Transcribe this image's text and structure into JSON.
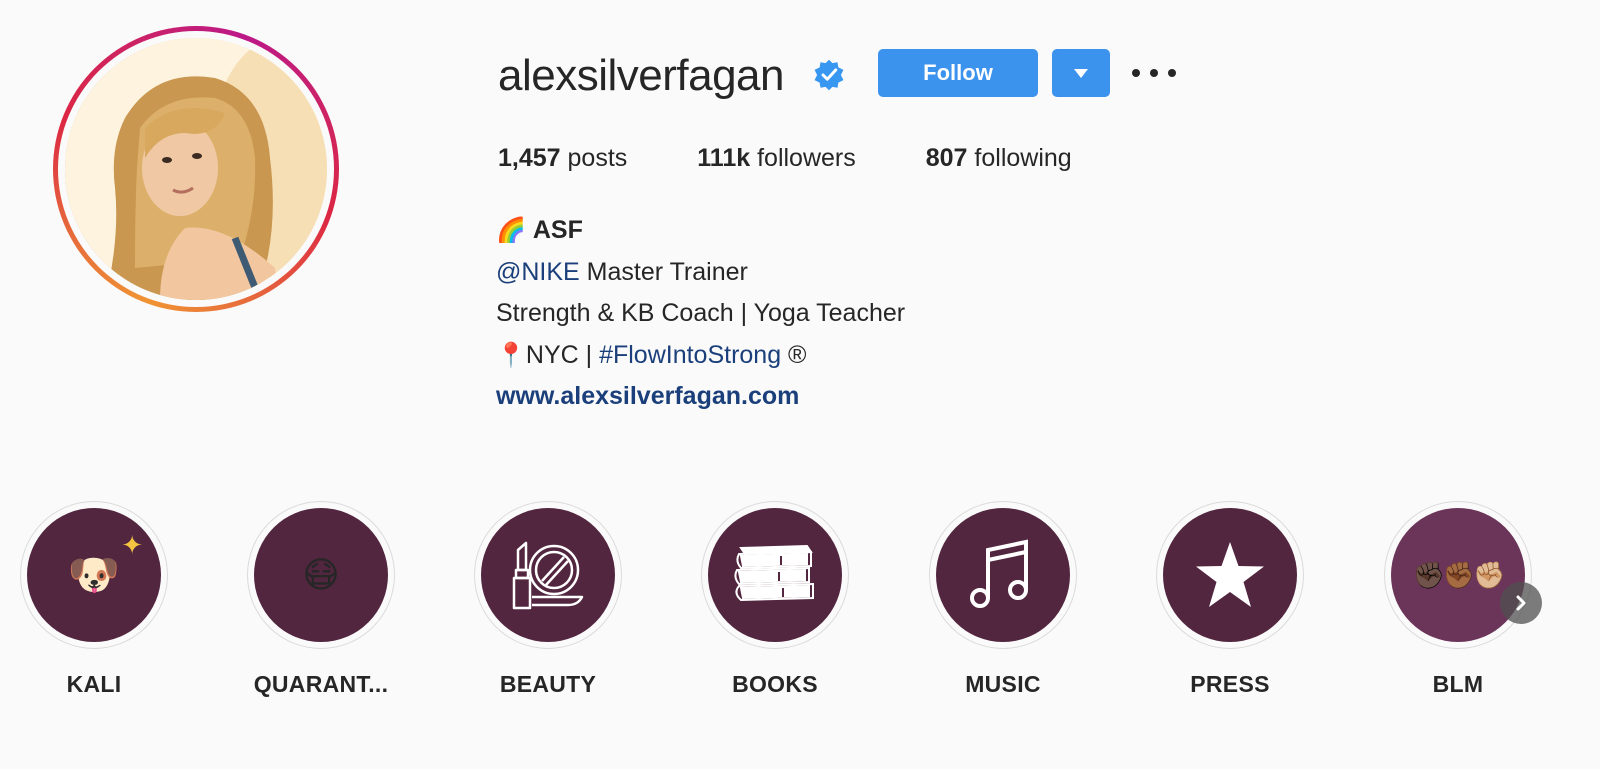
{
  "profile": {
    "username": "alexsilverfagan",
    "verified": true,
    "avatar_alt": "profile photo"
  },
  "actions": {
    "follow_label": "Follow",
    "dropdown_icon": "triangle-down-icon",
    "more_icon": "more-options-icon"
  },
  "stats": {
    "posts_count": "1,457",
    "posts_label": "posts",
    "followers_count": "111k",
    "followers_label": "followers",
    "following_count": "807",
    "following_label": "following"
  },
  "bio": {
    "name_emoji": "🌈",
    "name": "ASF",
    "line1_mention": "@NIKE",
    "line1_text": " Master Trainer",
    "line2_text": "Strength & KB Coach | Yoga Teacher",
    "line3_emoji": "📍",
    "line3_text": "NYC | ",
    "line3_hashtag": "#FlowIntoStrong",
    "line3_suffix": " ®",
    "website": "www.alexsilverfagan.com"
  },
  "highlights": [
    {
      "label": "KALI",
      "icon": "dog-emoji-icon",
      "emoji": "🐶"
    },
    {
      "label": "QUARANT...",
      "icon": "mask-face-emoji-icon",
      "emoji": "😷"
    },
    {
      "label": "BEAUTY",
      "icon": "lipstick-mirror-icon"
    },
    {
      "label": "BOOKS",
      "icon": "books-icon"
    },
    {
      "label": "MUSIC",
      "icon": "music-note-icon"
    },
    {
      "label": "PRESS",
      "icon": "star-icon"
    },
    {
      "label": "BLM",
      "icon": "raised-fists-icon",
      "emoji": "✊🏿✊🏾✊🏼"
    }
  ],
  "colors": {
    "accent": "#3b93ed",
    "highlight_bg": "#532640",
    "link": "#1a3f7a"
  }
}
